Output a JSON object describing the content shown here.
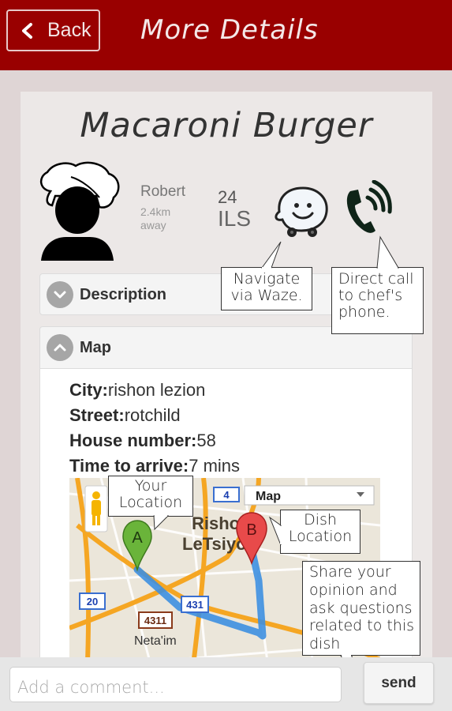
{
  "header": {
    "back_label": "Back",
    "title": "More Details",
    "bar_color": "#990000"
  },
  "dish": {
    "name": "Macaroni Burger",
    "chef_name": "Robert",
    "distance": "2.4km away",
    "price": "24",
    "currency": "ILS"
  },
  "actions": {
    "waze_icon": "waze-icon",
    "phone_icon": "phone-call-icon"
  },
  "sections": {
    "description": {
      "label": "Description",
      "state": "collapsed",
      "icon": "chevron-down-icon"
    },
    "map": {
      "label": "Map",
      "state": "expanded",
      "icon": "chevron-up-icon"
    }
  },
  "address": {
    "city_label": "City:",
    "city": "rishon lezion",
    "street_label": "Street:",
    "street": "rotchild",
    "house_label": "House number:",
    "house": "58",
    "time_label": "Time to arrive:",
    "time": "7 mins"
  },
  "map": {
    "type_select": "Map",
    "city_label_1": "Rishon",
    "city_label_2": "LeTsiyon",
    "district_label": "Neta'im",
    "marker_a": "A",
    "marker_b": "B",
    "road_shields": [
      "4",
      "20",
      "431",
      "4311"
    ],
    "route_color": "#3d8fe0"
  },
  "callouts": {
    "waze": "Navigate via Waze.",
    "call": "Direct call to chef's phone.",
    "your_location": "Your Location",
    "dish_location": "Dish Location",
    "share": "Share your opinion and ask questions related to this dish"
  },
  "comment": {
    "placeholder": "Add a comment...",
    "value": "",
    "send_label": "send"
  }
}
